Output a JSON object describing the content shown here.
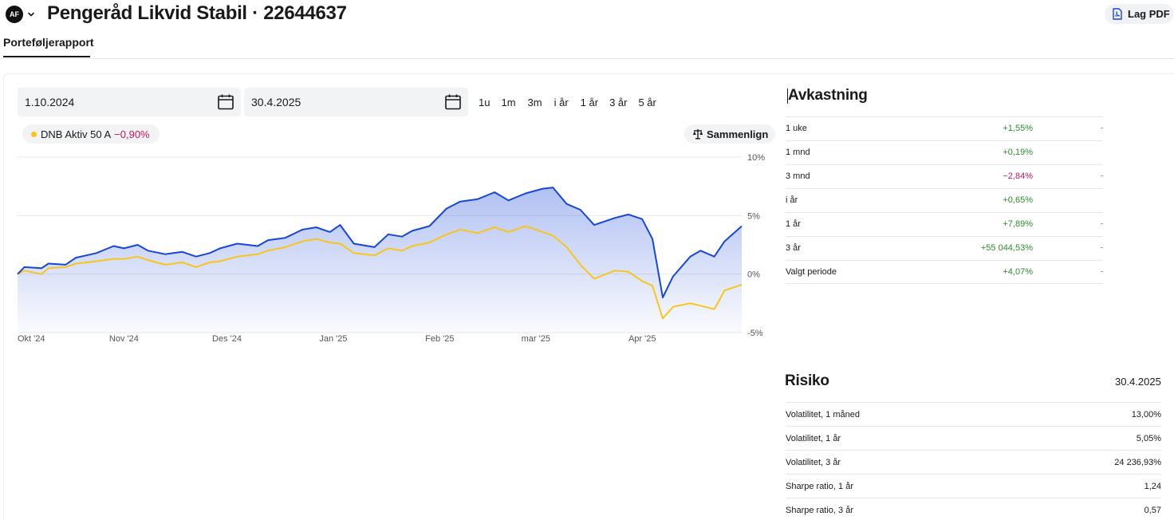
{
  "header": {
    "avatar_initials": "AF",
    "title": "Pengeråd Likvid Stabil · 22644637",
    "pdf_label": "Lag PDF"
  },
  "tabs": [
    {
      "label": "Porteføljerapport",
      "active": true
    }
  ],
  "filters": {
    "from_date": "1.10.2024",
    "to_date": "30.4.2025",
    "ranges": [
      "1u",
      "1m",
      "3m",
      "i år",
      "1 år",
      "3 år",
      "5 år"
    ]
  },
  "benchmark": {
    "name": "DNB Aktiv 50 A",
    "change": "−0,90%",
    "color": "#f7c51c"
  },
  "compare_label": "Sammenlign",
  "colors": {
    "portfolio": "#1747d9",
    "benchmark": "#f7c51c",
    "positive": "#2e8b2e",
    "negative": "#c2185b"
  },
  "icons": {
    "avatar_menu": "chevron-down-icon",
    "pdf": "pdf-icon",
    "date_picker": "calendar-icon",
    "compare": "scale-icon"
  },
  "chart_data": {
    "type": "line",
    "x_range": [
      "2024-10-01",
      "2025-04-30"
    ],
    "xticks": [
      {
        "label": "Okt '24",
        "date": "2024-10-01"
      },
      {
        "label": "Nov '24",
        "date": "2024-11-01"
      },
      {
        "label": "Des '24",
        "date": "2024-12-01"
      },
      {
        "label": "Jan '25",
        "date": "2025-01-01"
      },
      {
        "label": "Feb '25",
        "date": "2025-02-01"
      },
      {
        "label": "mar '25",
        "date": "2025-03-01"
      },
      {
        "label": "Apr '25",
        "date": "2025-04-01"
      }
    ],
    "ylim": [
      -5,
      10
    ],
    "yticks": [
      {
        "label": "10%",
        "value": 10
      },
      {
        "label": "5%",
        "value": 5
      },
      {
        "label": "0%",
        "value": 0
      },
      {
        "label": "-5%",
        "value": -5
      }
    ],
    "grid": true,
    "series": [
      {
        "color": "#1747d9",
        "fill": true,
        "points": [
          [
            "2024-10-01",
            0
          ],
          [
            "2024-10-03",
            0.6
          ],
          [
            "2024-10-08",
            0.5
          ],
          [
            "2024-10-10",
            0.9
          ],
          [
            "2024-10-15",
            0.8
          ],
          [
            "2024-10-18",
            1.4
          ],
          [
            "2024-10-24",
            1.8
          ],
          [
            "2024-10-29",
            2.4
          ],
          [
            "2024-11-01",
            2.2
          ],
          [
            "2024-11-05",
            2.5
          ],
          [
            "2024-11-08",
            2.0
          ],
          [
            "2024-11-13",
            1.7
          ],
          [
            "2024-11-18",
            1.9
          ],
          [
            "2024-11-22",
            1.5
          ],
          [
            "2024-11-26",
            1.8
          ],
          [
            "2024-11-29",
            2.2
          ],
          [
            "2024-12-04",
            2.6
          ],
          [
            "2024-12-10",
            2.4
          ],
          [
            "2024-12-13",
            2.9
          ],
          [
            "2024-12-18",
            3.1
          ],
          [
            "2024-12-23",
            3.8
          ],
          [
            "2024-12-27",
            4.0
          ],
          [
            "2024-12-31",
            3.6
          ],
          [
            "2025-01-03",
            4.2
          ],
          [
            "2025-01-07",
            2.6
          ],
          [
            "2025-01-13",
            2.3
          ],
          [
            "2025-01-17",
            3.4
          ],
          [
            "2025-01-21",
            3.2
          ],
          [
            "2025-01-24",
            3.7
          ],
          [
            "2025-01-29",
            4.1
          ],
          [
            "2025-02-03",
            5.6
          ],
          [
            "2025-02-07",
            6.2
          ],
          [
            "2025-02-12",
            6.4
          ],
          [
            "2025-02-17",
            7.0
          ],
          [
            "2025-02-21",
            6.3
          ],
          [
            "2025-02-26",
            6.9
          ],
          [
            "2025-03-03",
            7.3
          ],
          [
            "2025-03-06",
            7.4
          ],
          [
            "2025-03-10",
            6.0
          ],
          [
            "2025-03-14",
            5.5
          ],
          [
            "2025-03-18",
            4.2
          ],
          [
            "2025-03-24",
            4.8
          ],
          [
            "2025-03-28",
            5.1
          ],
          [
            "2025-04-01",
            4.7
          ],
          [
            "2025-04-04",
            3.0
          ],
          [
            "2025-04-07",
            -2.0
          ],
          [
            "2025-04-10",
            -0.2
          ],
          [
            "2025-04-15",
            1.5
          ],
          [
            "2025-04-18",
            2.0
          ],
          [
            "2025-04-22",
            1.5
          ],
          [
            "2025-04-25",
            2.8
          ],
          [
            "2025-04-30",
            4.1
          ]
        ]
      },
      {
        "name": "DNB Aktiv 50 A",
        "color": "#f7c51c",
        "fill": false,
        "points": [
          [
            "2024-10-01",
            0
          ],
          [
            "2024-10-03",
            0.3
          ],
          [
            "2024-10-08",
            0.0
          ],
          [
            "2024-10-10",
            0.5
          ],
          [
            "2024-10-15",
            0.6
          ],
          [
            "2024-10-18",
            0.9
          ],
          [
            "2024-10-24",
            1.1
          ],
          [
            "2024-10-29",
            1.3
          ],
          [
            "2024-11-01",
            1.3
          ],
          [
            "2024-11-05",
            1.5
          ],
          [
            "2024-11-08",
            1.2
          ],
          [
            "2024-11-13",
            0.8
          ],
          [
            "2024-11-18",
            1.0
          ],
          [
            "2024-11-22",
            0.6
          ],
          [
            "2024-11-26",
            1.0
          ],
          [
            "2024-11-29",
            1.1
          ],
          [
            "2024-12-04",
            1.5
          ],
          [
            "2024-12-10",
            1.7
          ],
          [
            "2024-12-13",
            2.0
          ],
          [
            "2024-12-18",
            2.3
          ],
          [
            "2024-12-23",
            2.8
          ],
          [
            "2024-12-27",
            3.0
          ],
          [
            "2024-12-31",
            2.7
          ],
          [
            "2025-01-03",
            2.6
          ],
          [
            "2025-01-07",
            1.8
          ],
          [
            "2025-01-13",
            1.6
          ],
          [
            "2025-01-17",
            2.2
          ],
          [
            "2025-01-21",
            2.0
          ],
          [
            "2025-01-24",
            2.4
          ],
          [
            "2025-01-29",
            2.7
          ],
          [
            "2025-02-03",
            3.4
          ],
          [
            "2025-02-07",
            3.8
          ],
          [
            "2025-02-12",
            3.5
          ],
          [
            "2025-02-17",
            4.0
          ],
          [
            "2025-02-21",
            3.6
          ],
          [
            "2025-02-26",
            4.1
          ],
          [
            "2025-03-03",
            3.6
          ],
          [
            "2025-03-06",
            3.3
          ],
          [
            "2025-03-10",
            2.3
          ],
          [
            "2025-03-14",
            0.8
          ],
          [
            "2025-03-18",
            -0.4
          ],
          [
            "2025-03-24",
            0.3
          ],
          [
            "2025-03-28",
            0.2
          ],
          [
            "2025-04-01",
            -0.6
          ],
          [
            "2025-04-04",
            -1.0
          ],
          [
            "2025-04-07",
            -3.8
          ],
          [
            "2025-04-10",
            -2.8
          ],
          [
            "2025-04-15",
            -2.5
          ],
          [
            "2025-04-18",
            -2.7
          ],
          [
            "2025-04-22",
            -3.0
          ],
          [
            "2025-04-25",
            -1.4
          ],
          [
            "2025-04-30",
            -0.9
          ]
        ]
      }
    ]
  },
  "returns": {
    "title": "Avkastning",
    "rows": [
      {
        "label": "1 uke",
        "value": "+1,55%",
        "sign": "pos",
        "trailing": "-"
      },
      {
        "label": "1 mnd",
        "value": "+0,19%",
        "sign": "pos",
        "trailing": ""
      },
      {
        "label": "3 mnd",
        "value": "−2,84%",
        "sign": "neg",
        "trailing": "-"
      },
      {
        "label": "i år",
        "value": "+0,65%",
        "sign": "pos",
        "trailing": ""
      },
      {
        "label": "1 år",
        "value": "+7,89%",
        "sign": "pos",
        "trailing": "-"
      },
      {
        "label": "3 år",
        "value": "+55 044,53%",
        "sign": "pos",
        "trailing": "-"
      },
      {
        "label": "Valgt periode",
        "value": "+4,07%",
        "sign": "pos",
        "trailing": "-"
      }
    ]
  },
  "risk": {
    "title": "Risiko",
    "date": "30.4.2025",
    "rows": [
      {
        "label": "Volatilitet, 1 måned",
        "value": "13,00%"
      },
      {
        "label": "Volatilitet, 1 år",
        "value": "5,05%"
      },
      {
        "label": "Volatilitet, 3 år",
        "value": "24 236,93%"
      },
      {
        "label": "Sharpe ratio, 1 år",
        "value": "1,24"
      },
      {
        "label": "Sharpe ratio, 3 år",
        "value": "0,57"
      }
    ]
  }
}
